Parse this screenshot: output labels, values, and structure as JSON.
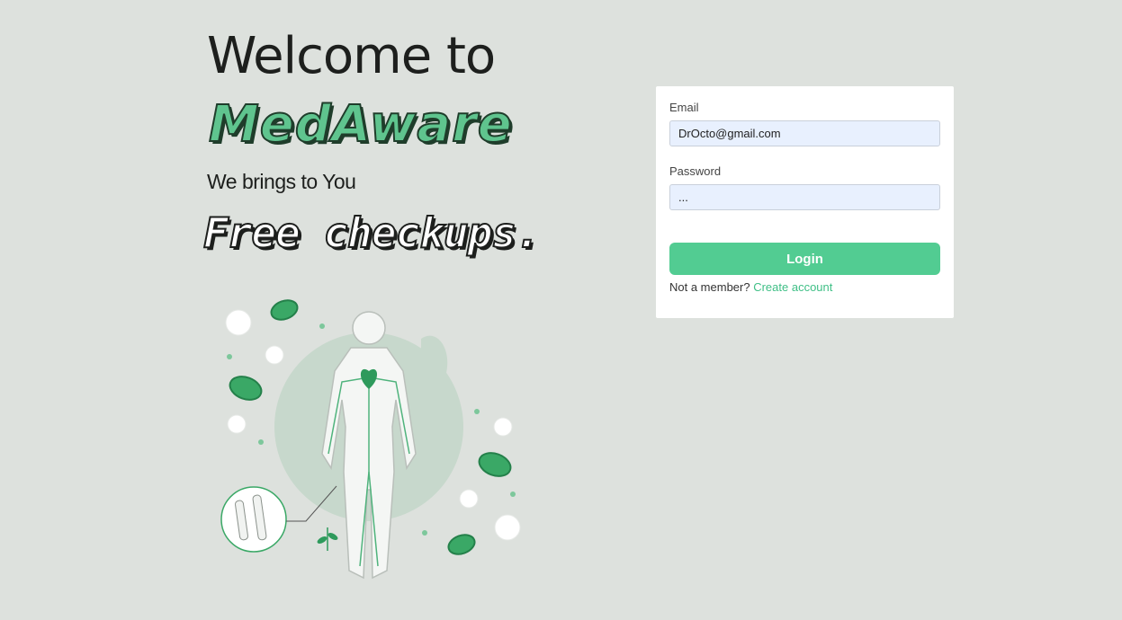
{
  "hero": {
    "welcome": "Welcome to",
    "brand": "MedAware",
    "tagline": "We brings to You",
    "highlight": "Free checkups."
  },
  "login_form": {
    "email_label": "Email",
    "email_value": "DrOcto@gmail.com",
    "password_label": "Password",
    "password_value": "...",
    "submit_label": "Login",
    "member_prompt": "Not a member?",
    "create_account_label": "Create account"
  },
  "colors": {
    "background": "#dde1dd",
    "accent": "#52cc92",
    "link": "#3fbf86",
    "input_fill": "#e8f0fe"
  },
  "icons": [
    "human-body-illustration",
    "blood-cell-icon",
    "plant-icon"
  ]
}
